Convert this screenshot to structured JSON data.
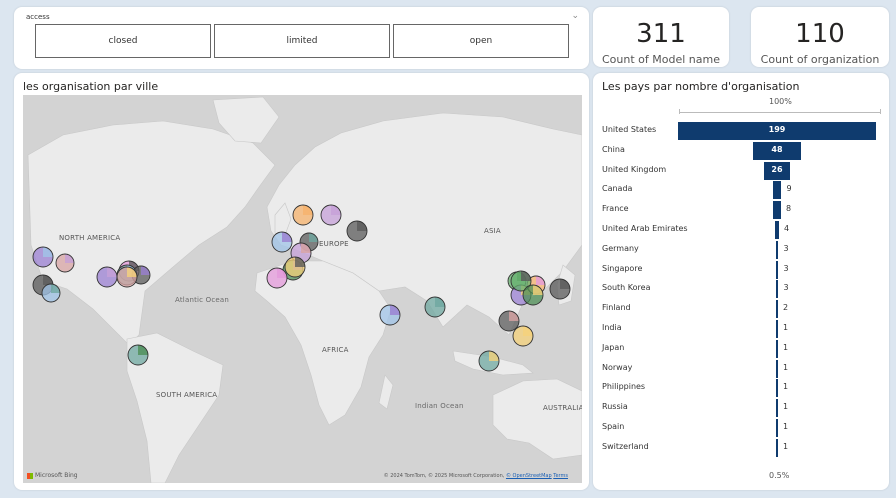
{
  "slicer": {
    "title": "access",
    "options": [
      "closed",
      "limited",
      "open"
    ]
  },
  "kpis": [
    {
      "value": "311",
      "label": "Count of Model name"
    },
    {
      "value": "110",
      "label": "Count of organization"
    }
  ],
  "map": {
    "title": "les organisation par ville",
    "labels": {
      "north_america": "NORTH AMERICA",
      "europe": "EUROPE",
      "asia": "ASIA",
      "atlantic": "Atlantic Ocean",
      "africa": "AFRICA",
      "south_america": "SOUTH AMERICA",
      "indian": "Indian Ocean",
      "australia": "AUSTRALIA"
    },
    "bing": "Microsoft Bing",
    "attribution": "© 2024 TomTom, © 2025 Microsoft Corporation,",
    "attribution_link": "© OpenStreetMap",
    "attribution_terms": "Terms",
    "colors": {
      "land": "#ebebeb",
      "water": "#d3d3d3",
      "bubble_palette": [
        "#9a7fd1",
        "#f6b26b",
        "#c6a0d8",
        "#5b5b5b",
        "#a0c4e8",
        "#6fa8a0",
        "#d8a4a4",
        "#4e8f56",
        "#e49adb",
        "#f5d27a",
        "#67b26f"
      ]
    }
  },
  "funnel": {
    "title": "Les pays par nombre d'organisation",
    "top_label": "100%",
    "bottom_label": "0.5%",
    "bar_color": "#0f3b6e",
    "rows": [
      {
        "country": "United States",
        "value": "199",
        "n": 199
      },
      {
        "country": "China",
        "value": "48",
        "n": 48
      },
      {
        "country": "United Kingdom",
        "value": "26",
        "n": 26
      },
      {
        "country": "Canada",
        "value": "9",
        "n": 9
      },
      {
        "country": "France",
        "value": "8",
        "n": 8
      },
      {
        "country": "United Arab Emirates",
        "value": "4",
        "n": 4
      },
      {
        "country": "Germany",
        "value": "3",
        "n": 3
      },
      {
        "country": "Singapore",
        "value": "3",
        "n": 3
      },
      {
        "country": "South Korea",
        "value": "3",
        "n": 3
      },
      {
        "country": "Finland",
        "value": "2",
        "n": 2
      },
      {
        "country": "India",
        "value": "1",
        "n": 1
      },
      {
        "country": "Japan",
        "value": "1",
        "n": 1
      },
      {
        "country": "Norway",
        "value": "1",
        "n": 1
      },
      {
        "country": "Philippines",
        "value": "1",
        "n": 1
      },
      {
        "country": "Russia",
        "value": "1",
        "n": 1
      },
      {
        "country": "Spain",
        "value": "1",
        "n": 1
      },
      {
        "country": "Switzerland",
        "value": "1",
        "n": 1
      }
    ]
  }
}
